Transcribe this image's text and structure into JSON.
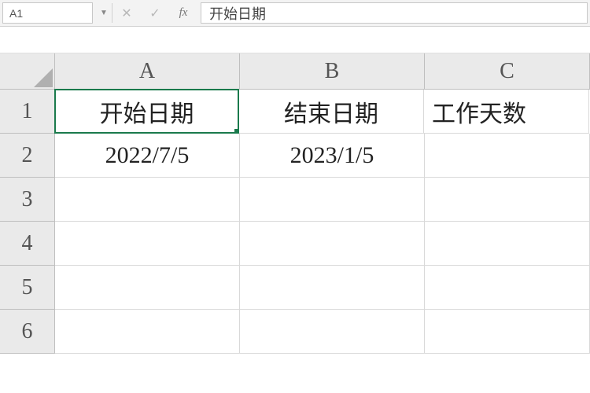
{
  "formula_bar": {
    "name_box": "A1",
    "formula_value": "开始日期"
  },
  "columns": [
    "A",
    "B",
    "C"
  ],
  "rows": [
    "1",
    "2",
    "3",
    "4",
    "5",
    "6"
  ],
  "cells": {
    "A1": "开始日期",
    "B1": "结束日期",
    "C1": "工作天数",
    "A2": "2022/7/5",
    "B2": "2023/1/5",
    "C2": "",
    "A3": "",
    "B3": "",
    "C3": "",
    "A4": "",
    "B4": "",
    "C4": "",
    "A5": "",
    "B5": "",
    "C5": "",
    "A6": "",
    "B6": "",
    "C6": ""
  },
  "selected_cell": "A1"
}
